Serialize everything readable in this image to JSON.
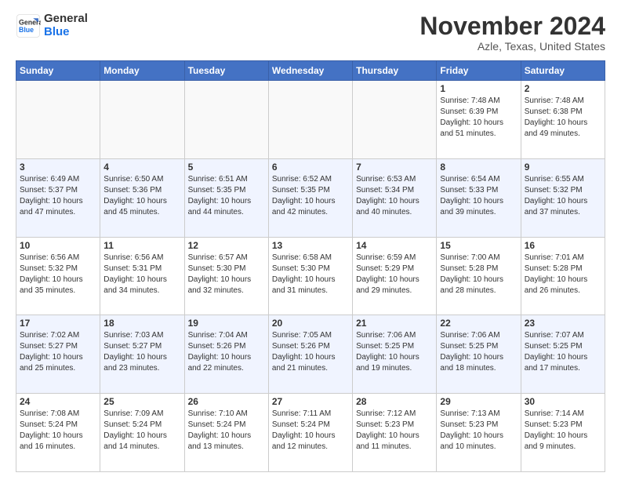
{
  "header": {
    "logo_line1": "General",
    "logo_line2": "Blue",
    "month": "November 2024",
    "location": "Azle, Texas, United States"
  },
  "weekdays": [
    "Sunday",
    "Monday",
    "Tuesday",
    "Wednesday",
    "Thursday",
    "Friday",
    "Saturday"
  ],
  "weeks": [
    [
      {
        "day": "",
        "info": ""
      },
      {
        "day": "",
        "info": ""
      },
      {
        "day": "",
        "info": ""
      },
      {
        "day": "",
        "info": ""
      },
      {
        "day": "",
        "info": ""
      },
      {
        "day": "1",
        "info": "Sunrise: 7:48 AM\nSunset: 6:39 PM\nDaylight: 10 hours\nand 51 minutes."
      },
      {
        "day": "2",
        "info": "Sunrise: 7:48 AM\nSunset: 6:38 PM\nDaylight: 10 hours\nand 49 minutes."
      }
    ],
    [
      {
        "day": "3",
        "info": "Sunrise: 6:49 AM\nSunset: 5:37 PM\nDaylight: 10 hours\nand 47 minutes."
      },
      {
        "day": "4",
        "info": "Sunrise: 6:50 AM\nSunset: 5:36 PM\nDaylight: 10 hours\nand 45 minutes."
      },
      {
        "day": "5",
        "info": "Sunrise: 6:51 AM\nSunset: 5:35 PM\nDaylight: 10 hours\nand 44 minutes."
      },
      {
        "day": "6",
        "info": "Sunrise: 6:52 AM\nSunset: 5:35 PM\nDaylight: 10 hours\nand 42 minutes."
      },
      {
        "day": "7",
        "info": "Sunrise: 6:53 AM\nSunset: 5:34 PM\nDaylight: 10 hours\nand 40 minutes."
      },
      {
        "day": "8",
        "info": "Sunrise: 6:54 AM\nSunset: 5:33 PM\nDaylight: 10 hours\nand 39 minutes."
      },
      {
        "day": "9",
        "info": "Sunrise: 6:55 AM\nSunset: 5:32 PM\nDaylight: 10 hours\nand 37 minutes."
      }
    ],
    [
      {
        "day": "10",
        "info": "Sunrise: 6:56 AM\nSunset: 5:32 PM\nDaylight: 10 hours\nand 35 minutes."
      },
      {
        "day": "11",
        "info": "Sunrise: 6:56 AM\nSunset: 5:31 PM\nDaylight: 10 hours\nand 34 minutes."
      },
      {
        "day": "12",
        "info": "Sunrise: 6:57 AM\nSunset: 5:30 PM\nDaylight: 10 hours\nand 32 minutes."
      },
      {
        "day": "13",
        "info": "Sunrise: 6:58 AM\nSunset: 5:30 PM\nDaylight: 10 hours\nand 31 minutes."
      },
      {
        "day": "14",
        "info": "Sunrise: 6:59 AM\nSunset: 5:29 PM\nDaylight: 10 hours\nand 29 minutes."
      },
      {
        "day": "15",
        "info": "Sunrise: 7:00 AM\nSunset: 5:28 PM\nDaylight: 10 hours\nand 28 minutes."
      },
      {
        "day": "16",
        "info": "Sunrise: 7:01 AM\nSunset: 5:28 PM\nDaylight: 10 hours\nand 26 minutes."
      }
    ],
    [
      {
        "day": "17",
        "info": "Sunrise: 7:02 AM\nSunset: 5:27 PM\nDaylight: 10 hours\nand 25 minutes."
      },
      {
        "day": "18",
        "info": "Sunrise: 7:03 AM\nSunset: 5:27 PM\nDaylight: 10 hours\nand 23 minutes."
      },
      {
        "day": "19",
        "info": "Sunrise: 7:04 AM\nSunset: 5:26 PM\nDaylight: 10 hours\nand 22 minutes."
      },
      {
        "day": "20",
        "info": "Sunrise: 7:05 AM\nSunset: 5:26 PM\nDaylight: 10 hours\nand 21 minutes."
      },
      {
        "day": "21",
        "info": "Sunrise: 7:06 AM\nSunset: 5:25 PM\nDaylight: 10 hours\nand 19 minutes."
      },
      {
        "day": "22",
        "info": "Sunrise: 7:06 AM\nSunset: 5:25 PM\nDaylight: 10 hours\nand 18 minutes."
      },
      {
        "day": "23",
        "info": "Sunrise: 7:07 AM\nSunset: 5:25 PM\nDaylight: 10 hours\nand 17 minutes."
      }
    ],
    [
      {
        "day": "24",
        "info": "Sunrise: 7:08 AM\nSunset: 5:24 PM\nDaylight: 10 hours\nand 16 minutes."
      },
      {
        "day": "25",
        "info": "Sunrise: 7:09 AM\nSunset: 5:24 PM\nDaylight: 10 hours\nand 14 minutes."
      },
      {
        "day": "26",
        "info": "Sunrise: 7:10 AM\nSunset: 5:24 PM\nDaylight: 10 hours\nand 13 minutes."
      },
      {
        "day": "27",
        "info": "Sunrise: 7:11 AM\nSunset: 5:24 PM\nDaylight: 10 hours\nand 12 minutes."
      },
      {
        "day": "28",
        "info": "Sunrise: 7:12 AM\nSunset: 5:23 PM\nDaylight: 10 hours\nand 11 minutes."
      },
      {
        "day": "29",
        "info": "Sunrise: 7:13 AM\nSunset: 5:23 PM\nDaylight: 10 hours\nand 10 minutes."
      },
      {
        "day": "30",
        "info": "Sunrise: 7:14 AM\nSunset: 5:23 PM\nDaylight: 10 hours\nand 9 minutes."
      }
    ]
  ]
}
